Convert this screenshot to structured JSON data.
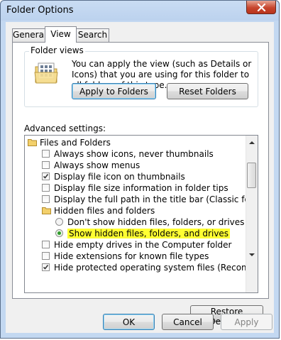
{
  "window": {
    "title": "Folder Options"
  },
  "tabs": [
    {
      "label": "General",
      "active": false
    },
    {
      "label": "View",
      "active": true
    },
    {
      "label": "Search",
      "active": false
    }
  ],
  "folder_views": {
    "group_label": "Folder views",
    "description": "You can apply the view (such as Details or Icons) that you are using for this folder to all folders of this type.",
    "apply_button": "Apply to Folders",
    "reset_button": "Reset Folders"
  },
  "advanced": {
    "label": "Advanced settings:",
    "items": [
      {
        "type": "folder",
        "label": "Files and Folders"
      },
      {
        "type": "checkbox",
        "checked": false,
        "label": "Always show icons, never thumbnails"
      },
      {
        "type": "checkbox",
        "checked": false,
        "label": "Always show menus"
      },
      {
        "type": "checkbox",
        "checked": true,
        "label": "Display file icon on thumbnails"
      },
      {
        "type": "checkbox",
        "checked": false,
        "label": "Display file size information in folder tips"
      },
      {
        "type": "checkbox",
        "checked": false,
        "label": "Display the full path in the title bar (Classic folders only)"
      },
      {
        "type": "folder",
        "label": "Hidden files and folders"
      },
      {
        "type": "radio",
        "checked": false,
        "label": "Don't show hidden files, folders, or drives"
      },
      {
        "type": "radio",
        "checked": true,
        "highlight": true,
        "label": "Show hidden files, folders, and drives"
      },
      {
        "type": "checkbox",
        "checked": false,
        "label": "Hide empty drives in the Computer folder"
      },
      {
        "type": "checkbox",
        "checked": false,
        "label": "Hide extensions for known file types"
      },
      {
        "type": "checkbox",
        "checked": true,
        "label": "Hide protected operating system files (Recommended)"
      }
    ],
    "restore_button": "Restore Defaults"
  },
  "footer": {
    "ok": "OK",
    "cancel": "Cancel",
    "apply": "Apply"
  },
  "colors": {
    "highlight": "#ffff33",
    "window_frame": "#bcd2ee",
    "close_button": "#c7452d"
  }
}
